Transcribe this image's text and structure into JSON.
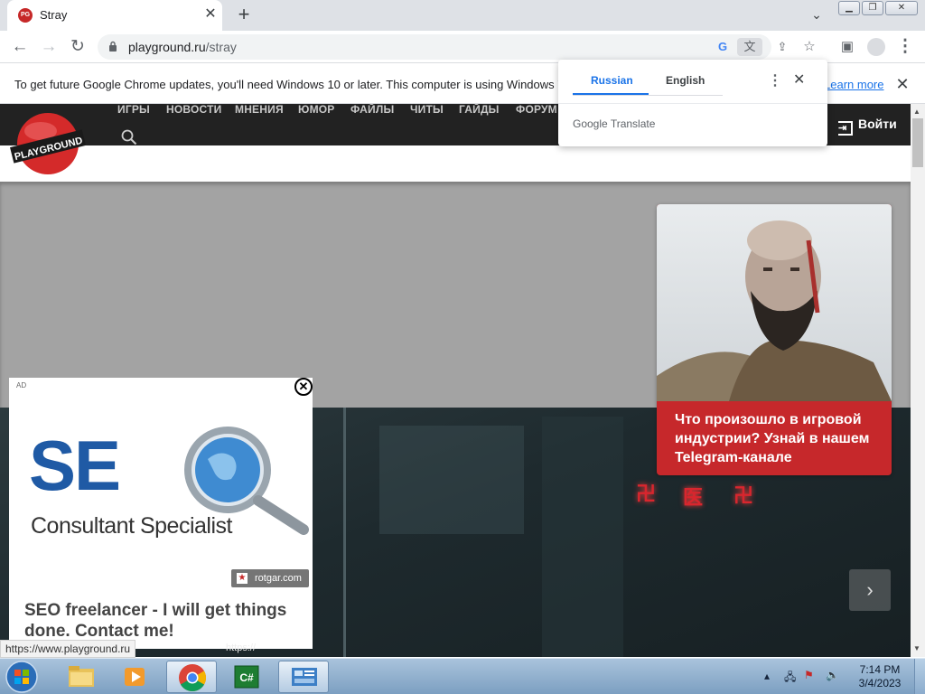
{
  "browser": {
    "tab_title": "Stray",
    "tab_favicon_text": "PG",
    "url_domain": "playground.ru",
    "url_path": "/stray",
    "icons": [
      "back-icon",
      "forward-icon",
      "reload-icon",
      "lock-icon",
      "google-icon",
      "translate-icon",
      "share-icon",
      "star-icon",
      "sidepanel-icon",
      "profile-icon",
      "menu-icon"
    ]
  },
  "infobar": {
    "text": "To get future Google Chrome updates, you'll need Windows 10 or later. This computer is using Windows 7.",
    "learn_more": "Learn more"
  },
  "translate_popup": {
    "tab_source": "Russian",
    "tab_target": "English",
    "brand": "Google Translate"
  },
  "site": {
    "nav": [
      "ИГРЫ",
      "НОВОСТИ",
      "МНЕНИЯ",
      "ЮМОР",
      "ФАЙЛЫ",
      "ЧИТЫ",
      "ГАЙДЫ",
      "ФОРУМ"
    ],
    "login": "Войти",
    "logo_text": "PLAYGROUND",
    "promo_text": "Что произошло в игровой индустрии? Узнай в нашем Telegram-канале",
    "neon_signs": [
      "卍",
      "医",
      "卍"
    ],
    "next_arrow": "›"
  },
  "ad": {
    "label": "AD",
    "logo_letters": "SE",
    "logo_subtitle": "Consultant Specialist",
    "domain": "rotgar.com",
    "copy": "SEO freelancer - I will get things done. Contact me!"
  },
  "status": {
    "url": "https://www.playground.ru",
    "hover_url": "https://"
  },
  "taskbar": {
    "time": "7:14 PM",
    "date": "3/4/2023",
    "apps": [
      "explorer-icon",
      "media-player-icon",
      "chrome-icon",
      "csharp-icon",
      "control-panel-icon"
    ]
  }
}
